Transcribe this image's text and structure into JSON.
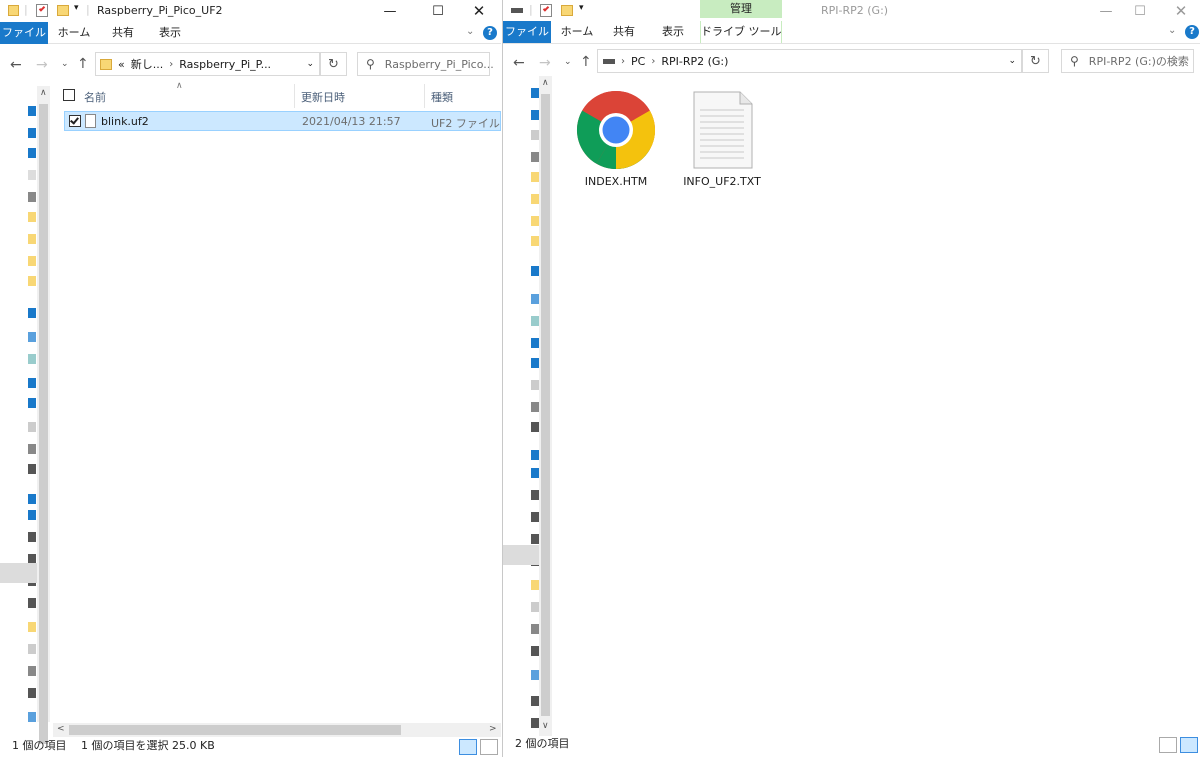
{
  "left": {
    "window_title": "Raspberry_Pi_Pico_UF2",
    "ribbon_tabs": [
      "ファイル",
      "ホーム",
      "共有",
      "表示"
    ],
    "address": {
      "overflow": "«",
      "crumb1": "新し...",
      "crumb2": "Raspberry_Pi_P..."
    },
    "search_placeholder": "Raspberry_Pi_Pico...",
    "columns": {
      "name": "名前",
      "date": "更新日時",
      "type": "種類"
    },
    "files": [
      {
        "name": "blink.uf2",
        "date": "2021/04/13 21:57",
        "type": "UF2 ファイル",
        "selected": true
      }
    ],
    "status": {
      "count": "1 個の項目",
      "selection": "1 個の項目を選択 25.0 KB"
    }
  },
  "right": {
    "window_title": "RPI-RP2 (G:)",
    "context_tab_group": "管理",
    "context_tab": "ドライブ ツール",
    "ribbon_tabs": [
      "ファイル",
      "ホーム",
      "共有",
      "表示"
    ],
    "address": {
      "crumb1": "PC",
      "crumb2": "RPI-RP2 (G:)"
    },
    "search_placeholder": "RPI-RP2 (G:)の検索",
    "files": [
      {
        "name": "INDEX.HTM",
        "icon": "chrome-icon"
      },
      {
        "name": "INFO_UF2.TXT",
        "icon": "text-file-icon"
      }
    ],
    "status": {
      "count": "2 個の項目"
    }
  },
  "colors": {
    "accent": "#1979ca",
    "selection": "#cce8ff",
    "context_tab": "#c8ecc0",
    "folder": "#f8d775"
  }
}
